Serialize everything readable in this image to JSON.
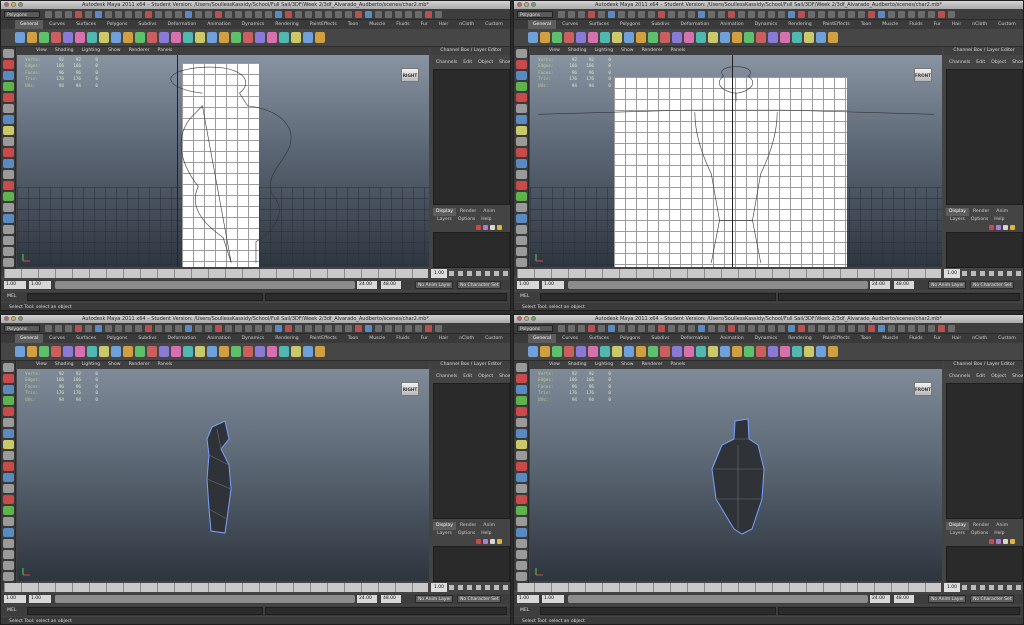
{
  "app": {
    "title": "Autodesk Maya 2011 x64 – Student Version: /Users/SoullessKassidy/School/Full Sail/3DF/Week 2/3df_Alvarado_Audberto/scenes/char2.mb*",
    "mode": "Polygons"
  },
  "shelf_tabs": [
    "General",
    "Curves",
    "Surfaces",
    "Polygons",
    "Subdivs",
    "Deformation",
    "Animation",
    "Dynamics",
    "Rendering",
    "PaintEffects",
    "Toon",
    "Muscle",
    "Fluids",
    "Fur",
    "Hair",
    "nCloth",
    "Custom"
  ],
  "viewport_menu": [
    "View",
    "Shading",
    "Lighting",
    "Show",
    "Renderer",
    "Panels"
  ],
  "hud": {
    "rows": [
      {
        "label": "Verts:",
        "values": [
          "92",
          "92",
          "0"
        ]
      },
      {
        "label": "Edges:",
        "values": [
          "166",
          "166",
          "0"
        ]
      },
      {
        "label": "Faces:",
        "values": [
          "96",
          "96",
          "0"
        ]
      },
      {
        "label": "Tris:",
        "values": [
          "176",
          "176",
          "0"
        ]
      },
      {
        "label": "UVs:",
        "values": [
          "94",
          "94",
          "0"
        ]
      }
    ]
  },
  "channel_box": {
    "header": "Channel Box / Layer Editor",
    "menu": [
      "Channels",
      "Edit",
      "Object",
      "Show"
    ]
  },
  "layer_editor": {
    "tabs": [
      "Display",
      "Render",
      "Anim"
    ],
    "menu": [
      "Layers",
      "Options",
      "Help"
    ]
  },
  "timeline": {
    "current": "1.00",
    "start": "1.00",
    "range_start": "1.00",
    "range_mid": "1",
    "range_end_marker": "24",
    "end": "24.00",
    "total_end": "48.00",
    "anim_layer": "No Anim Layer",
    "char_set": "No Character Set"
  },
  "command_line": {
    "label": "MEL"
  },
  "help_line": "Select Tool: select an object",
  "views": [
    {
      "cube_label": "RIGHT",
      "kind": "ref-side"
    },
    {
      "cube_label": "FRONT",
      "kind": "ref-front"
    },
    {
      "cube_label": "RIGHT",
      "kind": "mesh-side"
    },
    {
      "cube_label": "FRONT",
      "kind": "mesh-front"
    }
  ],
  "colors": {
    "accent": "#5d5d5d",
    "viewport_top": "#8894a2",
    "viewport_bottom": "#2e3640",
    "hud_text": "#dfe6c8"
  }
}
